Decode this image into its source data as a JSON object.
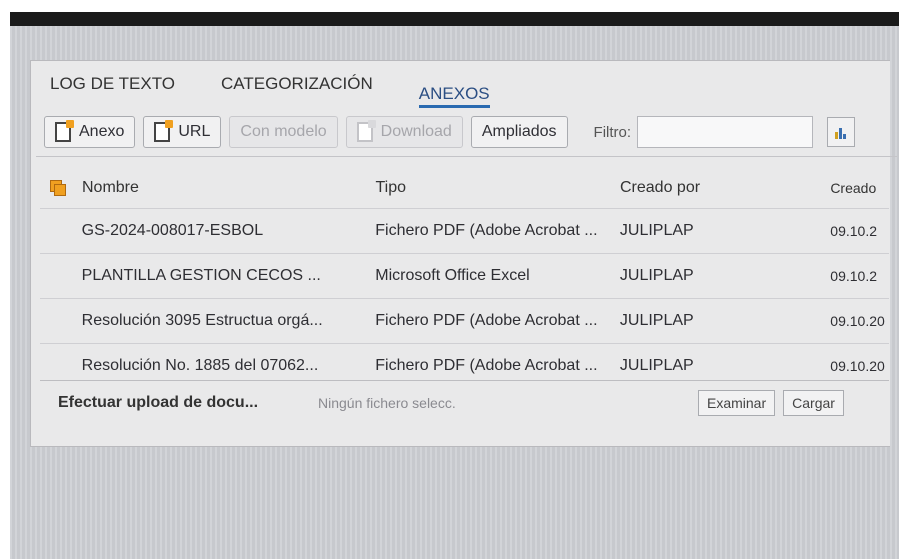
{
  "tabs": [
    {
      "label": "LOG DE TEXTO",
      "active": false
    },
    {
      "label": "CATEGORIZACIÓN",
      "active": false
    },
    {
      "label": "ANEXOS",
      "active": true
    }
  ],
  "toolbar": {
    "anexo_label": "Anexo",
    "url_label": "URL",
    "con_modelo_label": "Con modelo",
    "download_label": "Download",
    "ampliados_label": "Ampliados",
    "filtro_label": "Filtro:",
    "filtro_value": ""
  },
  "table": {
    "columns": [
      "Nombre",
      "Tipo",
      "Creado por",
      "Creado"
    ],
    "rows": [
      {
        "nombre": "GS-2024-008017-ESBOL",
        "tipo": "Fichero PDF (Adobe Acrobat ...",
        "creado_por": "JULIPLAP",
        "creado": "09.10.2"
      },
      {
        "nombre": "PLANTILLA GESTION CECOS ...",
        "tipo": "Microsoft Office Excel",
        "creado_por": "JULIPLAP",
        "creado": "09.10.2"
      },
      {
        "nombre": "Resolución 3095 Estructua orgá...",
        "tipo": "Fichero PDF (Adobe Acrobat ...",
        "creado_por": "JULIPLAP",
        "creado": "09.10.20"
      },
      {
        "nombre": "Resolución No. 1885 del 07062...",
        "tipo": "Fichero PDF (Adobe Acrobat ...",
        "creado_por": "JULIPLAP",
        "creado": "09.10.20"
      }
    ]
  },
  "upload": {
    "label": "Efectuar upload de docu...",
    "file_text": "Ningún fichero selecc.",
    "examinar_label": "Examinar",
    "cargar_label": "Cargar"
  },
  "colors": {
    "accent": "#2a6ab0",
    "icon": "#f0a020"
  }
}
